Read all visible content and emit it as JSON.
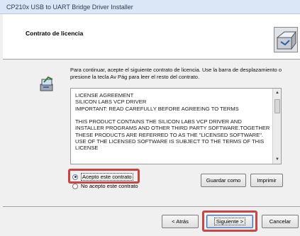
{
  "window": {
    "title": "CP210x USB to UART Bridge Driver Installer"
  },
  "header": {
    "title": "Contrato de licencia",
    "logo_icon": "installer-box-icon"
  },
  "intro": {
    "icon": "setup-icon",
    "text": "Para continuar, acepte el siguiente contrato de licencia. Use la barra de desplazamiento o presione la tecla Av Pág para leer el resto del contrato."
  },
  "license": {
    "text": "LICENSE AGREEMENT\nSILICON LABS VCP DRIVER\nIMPORTANT:  READ CAREFULLY BEFORE AGREEING TO TERMS\n\nTHIS PRODUCT CONTAINS THE SILICON LABS VCP DRIVER AND INSTALLER PROGRAMS AND OTHER THIRD PARTY SOFTWARE.TOGETHER THESE PRODUCTS ARE REFERRED TO AS THE \"LICENSED SOFTWARE\".  USE OF THE LICENSED SOFTWARE IS SUBJECT TO THE TERMS OF THIS LICENSE"
  },
  "options": {
    "accept_label": "Acepto este contrato",
    "accept_selected": true,
    "reject_label": "No acepto este contrato"
  },
  "buttons": {
    "save": "Guardar como",
    "print": "Imprimir",
    "back": "< Atrás",
    "next": "Siguiente >",
    "cancel": "Cancelar"
  },
  "colors": {
    "highlight": "#c94444",
    "title_bar": "#dbe7f6"
  }
}
